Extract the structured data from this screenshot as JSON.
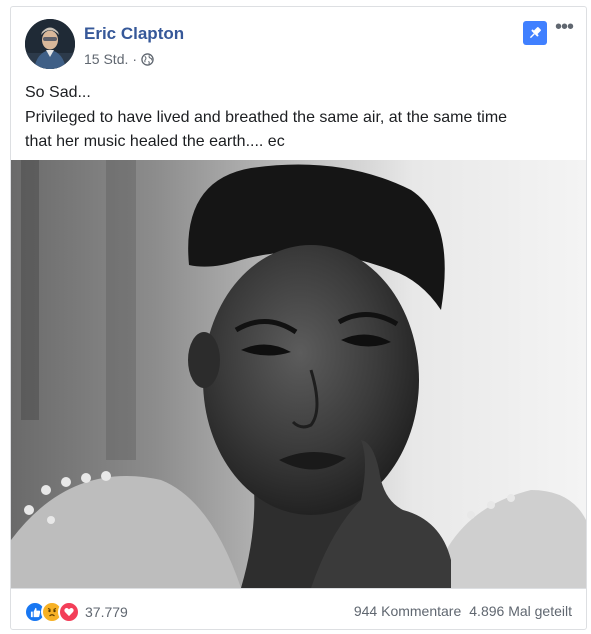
{
  "post": {
    "author": "Eric Clapton",
    "time": "15 Std.",
    "separator": "·",
    "privacy_icon": "globe-icon",
    "pin_icon": "pin-icon",
    "more_icon": "more-options-icon",
    "more_label": "•••",
    "text_lines": [
      "So Sad...",
      "Privileged to have lived and breathed the same air, at the same time",
      "that her music healed the earth.... ec"
    ]
  },
  "footer": {
    "reaction_icons": [
      "like-icon",
      "sad-icon",
      "love-icon"
    ],
    "reaction_count": "37.779",
    "comments": "944 Kommentare",
    "shares": "4.896 Mal geteilt"
  },
  "colors": {
    "author": "#365899",
    "pin": "#4080ff",
    "like": "#1877f2",
    "sad": "#f7b125",
    "love": "#f33e58",
    "border": "#dddfe2"
  }
}
